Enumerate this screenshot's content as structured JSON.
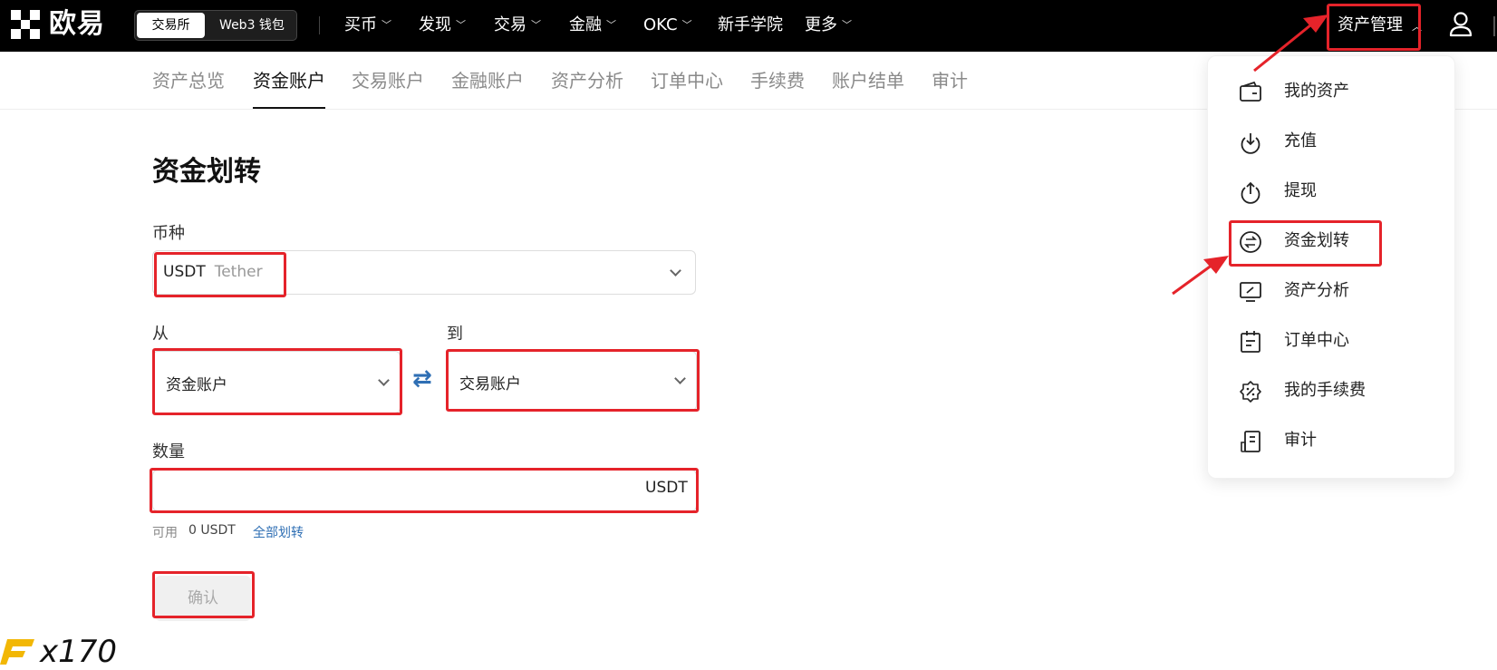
{
  "header": {
    "logo_text": "欧易",
    "mode_toggle": {
      "active": "交易所",
      "inactive": "Web3 钱包"
    },
    "nav": [
      {
        "label": "买币",
        "has_dropdown": true
      },
      {
        "label": "发现",
        "has_dropdown": true
      },
      {
        "label": "交易",
        "has_dropdown": true
      },
      {
        "label": "金融",
        "has_dropdown": true
      },
      {
        "label": "OKC",
        "has_dropdown": true
      },
      {
        "label": "新手学院",
        "has_dropdown": false
      },
      {
        "label": "更多",
        "has_dropdown": true
      }
    ],
    "asset_menu_label": "资产管理"
  },
  "subnav": {
    "tabs": [
      "资产总览",
      "资金账户",
      "交易账户",
      "金融账户",
      "资产分析",
      "订单中心",
      "手续费",
      "账户结单",
      "审计"
    ],
    "active": "资金账户"
  },
  "form": {
    "title": "资金划转",
    "currency_label": "币种",
    "currency_code": "USDT",
    "currency_name": "Tether",
    "from_label": "从",
    "from_value": "资金账户",
    "to_label": "到",
    "to_value": "交易账户",
    "amount_label": "数量",
    "amount_value": "",
    "amount_unit": "USDT",
    "available_label": "可用",
    "available_value": "0 USDT",
    "transfer_all": "全部划转",
    "confirm": "确认"
  },
  "asset_menu": {
    "items": [
      {
        "label": "我的资产",
        "icon": "wallet-icon"
      },
      {
        "label": "充值",
        "icon": "deposit-icon"
      },
      {
        "label": "提现",
        "icon": "withdraw-icon"
      },
      {
        "label": "资金划转",
        "icon": "transfer-icon"
      },
      {
        "label": "资产分析",
        "icon": "analysis-icon"
      },
      {
        "label": "订单中心",
        "icon": "order-icon"
      },
      {
        "label": "我的手续费",
        "icon": "fee-icon"
      },
      {
        "label": "审计",
        "icon": "audit-icon"
      }
    ]
  },
  "watermark": {
    "text": "x170"
  },
  "colors": {
    "highlight": "#e5232a",
    "link": "#2f6fb4",
    "header_bg": "#000000"
  }
}
